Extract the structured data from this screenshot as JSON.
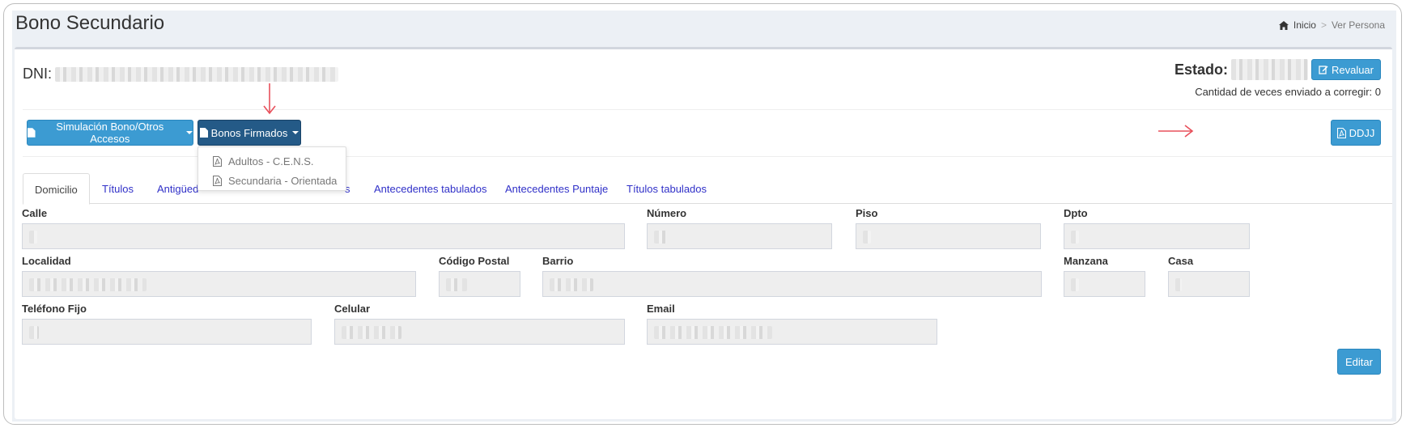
{
  "header": {
    "title": "Bono Secundario",
    "breadcrumb": {
      "home": "Inicio",
      "separator": ">",
      "current": "Ver Persona"
    }
  },
  "person": {
    "dni_label": "DNI:",
    "estado_label": "Estado:",
    "revaluar_label": "Revaluar",
    "corregir_text": "Cantidad de veces enviado a corregir: 0"
  },
  "toolbar": {
    "simulacion_label": "Simulación Bono/Otros Accesos",
    "firmados_label": "Bonos Firmados",
    "ddjj_label": "DDJJ",
    "dropdown_items": [
      "Adultos - C.E.N.S.",
      "Secundaria - Orientada"
    ]
  },
  "tabs": [
    {
      "label": "Domicilio",
      "active": true
    },
    {
      "label": "Títulos"
    },
    {
      "label": "Antigüed"
    },
    {
      "label": "s"
    },
    {
      "label": "Antecedentes tabulados"
    },
    {
      "label": "Antecedentes Puntaje"
    },
    {
      "label": "Títulos tabulados"
    }
  ],
  "form": {
    "calle": "Calle",
    "numero": "Número",
    "piso": "Piso",
    "dpto": "Dpto",
    "localidad": "Localidad",
    "codigo_postal": "Código Postal",
    "barrio": "Barrio",
    "manzana": "Manzana",
    "casa": "Casa",
    "telefono_fijo": "Teléfono Fijo",
    "celular": "Celular",
    "email": "Email",
    "editar_label": "Editar"
  },
  "colors": {
    "info_button": "#3c9bd2",
    "dark_button": "#245a87",
    "tab_link": "#3030c8",
    "annotation_arrow": "#e8505b"
  }
}
